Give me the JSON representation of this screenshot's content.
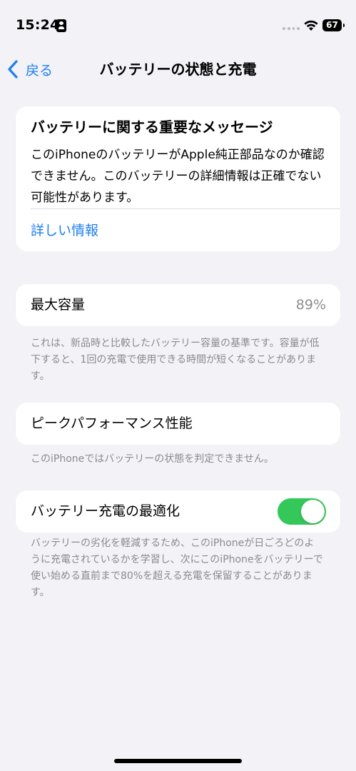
{
  "status_bar": {
    "time": "15:24",
    "battery_level": "67"
  },
  "nav": {
    "back_label": "戻る",
    "title": "バッテリーの状態と充電"
  },
  "warning": {
    "title": "バッテリーに関する重要なメッセージ",
    "body": "このiPhoneのバッテリーがApple純正部品なのか確認できません。このバッテリーの詳細情報は正確でない可能性があります。",
    "link": "詳しい情報"
  },
  "max_capacity": {
    "label": "最大容量",
    "value": "89%",
    "footnote": "これは、新品時と比較したバッテリー容量の基準です。容量が低下すると、1回の充電で使用できる時間が短くなることがあります。"
  },
  "peak_performance": {
    "label": "ピークパフォーマンス性能",
    "footnote": "このiPhoneではバッテリーの状態を判定できません。"
  },
  "optimized_charging": {
    "label": "バッテリー充電の最適化",
    "enabled": true,
    "footnote": "バッテリーの劣化を軽減するため、このiPhoneが日ごろどのように充電されているかを学習し、次にこのiPhoneをバッテリーで使い始める直前まで80%を超える充電を保留することがあります。"
  },
  "colors": {
    "accent": "#1f7ff0",
    "toggle_on": "#34c759",
    "background": "#f2f2f7"
  }
}
